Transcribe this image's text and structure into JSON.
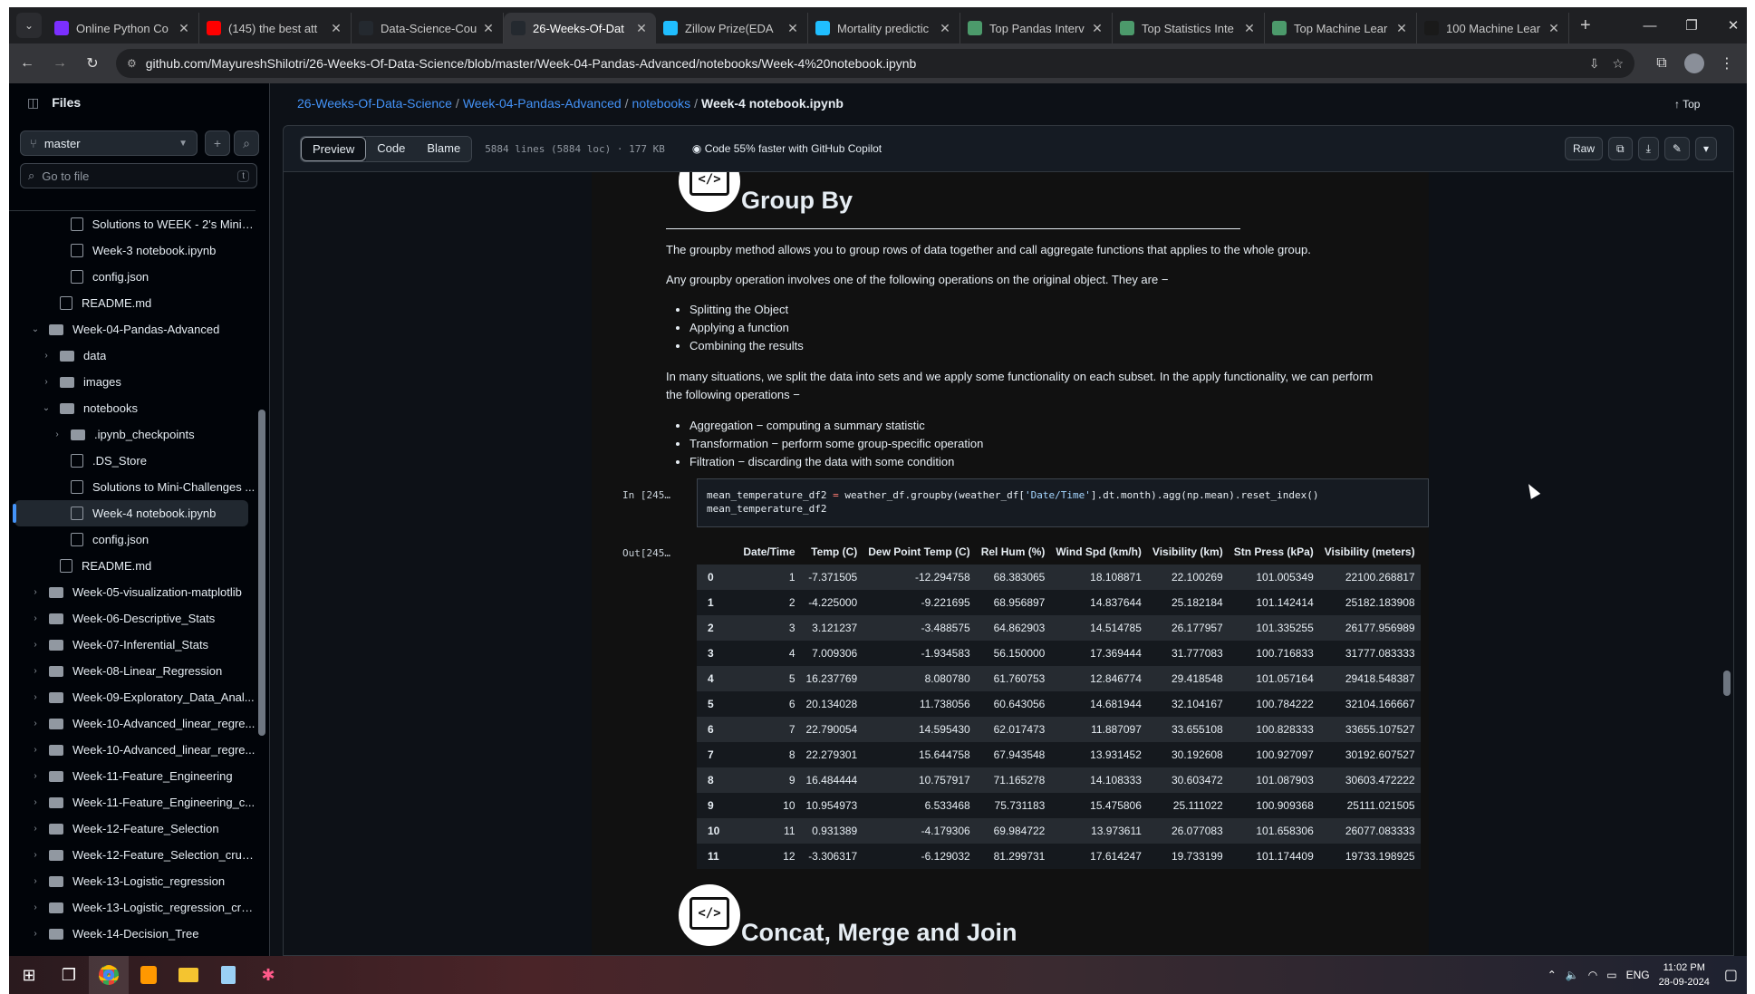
{
  "browser": {
    "tabs": [
      {
        "title": "Online Python Co",
        "icon": "python-icon",
        "color": "#7b2fff",
        "active": false
      },
      {
        "title": "(145) the best att",
        "icon": "youtube-icon",
        "color": "#ff0000",
        "active": false
      },
      {
        "title": "Data-Science-Cou",
        "icon": "github-icon",
        "color": "#24292f",
        "active": false
      },
      {
        "title": "26-Weeks-Of-Dat",
        "icon": "github-icon",
        "color": "#24292f",
        "active": true
      },
      {
        "title": "Zillow Prize(EDA",
        "icon": "kaggle-icon",
        "color": "#20beff",
        "active": false
      },
      {
        "title": "Mortality predictic",
        "icon": "kaggle-icon",
        "color": "#20beff",
        "active": false
      },
      {
        "title": "Top Pandas Interv",
        "icon": "website-icon",
        "color": "#4c9a6b",
        "active": false
      },
      {
        "title": "Top Statistics Inte",
        "icon": "website-icon",
        "color": "#4c9a6b",
        "active": false
      },
      {
        "title": "Top Machine Lear",
        "icon": "website-icon",
        "color": "#4c9a6b",
        "active": false
      },
      {
        "title": "100 Machine Lear",
        "icon": "website-icon",
        "color": "#1a1a1a",
        "active": false
      }
    ],
    "url": "github.com/MayureshShilotri/26-Weeks-Of-Data-Science/blob/master/Week-04-Pandas-Advanced/notebooks/Week-4%20notebook.ipynb"
  },
  "sidebar": {
    "title": "Files",
    "branch": "master",
    "search_placeholder": "Go to file",
    "search_shortcut": "t",
    "tree": [
      {
        "label": "Solutions to WEEK - 2's Mini C...",
        "type": "file",
        "depth": 2
      },
      {
        "label": "Week-3 notebook.ipynb",
        "type": "file",
        "depth": 2
      },
      {
        "label": "config.json",
        "type": "file",
        "depth": 2
      },
      {
        "label": "README.md",
        "type": "file",
        "depth": 1
      },
      {
        "label": "Week-04-Pandas-Advanced",
        "type": "dir-open",
        "depth": 0
      },
      {
        "label": "data",
        "type": "dir",
        "depth": 1
      },
      {
        "label": "images",
        "type": "dir",
        "depth": 1
      },
      {
        "label": "notebooks",
        "type": "dir-open",
        "depth": 1
      },
      {
        "label": ".ipynb_checkpoints",
        "type": "dir",
        "depth": 2
      },
      {
        "label": ".DS_Store",
        "type": "file",
        "depth": 2
      },
      {
        "label": "Solutions to Mini-Challenges ...",
        "type": "file",
        "depth": 2
      },
      {
        "label": "Week-4 notebook.ipynb",
        "type": "file",
        "depth": 2,
        "selected": true
      },
      {
        "label": "config.json",
        "type": "file",
        "depth": 2
      },
      {
        "label": "README.md",
        "type": "file",
        "depth": 1
      },
      {
        "label": "Week-05-visualization-matplotlib",
        "type": "dir",
        "depth": 0
      },
      {
        "label": "Week-06-Descriptive_Stats",
        "type": "dir",
        "depth": 0
      },
      {
        "label": "Week-07-Inferential_Stats",
        "type": "dir",
        "depth": 0
      },
      {
        "label": "Week-08-Linear_Regression",
        "type": "dir",
        "depth": 0
      },
      {
        "label": "Week-09-Exploratory_Data_Anal...",
        "type": "dir",
        "depth": 0
      },
      {
        "label": "Week-10-Advanced_linear_regre...",
        "type": "dir",
        "depth": 0
      },
      {
        "label": "Week-10-Advanced_linear_regre...",
        "type": "dir",
        "depth": 0
      },
      {
        "label": "Week-11-Feature_Engineering",
        "type": "dir",
        "depth": 0
      },
      {
        "label": "Week-11-Feature_Engineering_c...",
        "type": "dir",
        "depth": 0
      },
      {
        "label": "Week-12-Feature_Selection",
        "type": "dir",
        "depth": 0
      },
      {
        "label": "Week-12-Feature_Selection_cruc...",
        "type": "dir",
        "depth": 0
      },
      {
        "label": "Week-13-Logistic_regression",
        "type": "dir",
        "depth": 0
      },
      {
        "label": "Week-13-Logistic_regression_cru...",
        "type": "dir",
        "depth": 0
      },
      {
        "label": "Week-14-Decision_Tree",
        "type": "dir",
        "depth": 0
      }
    ]
  },
  "breadcrumb": {
    "parts": [
      "26-Weeks-Of-Data-Science",
      "Week-04-Pandas-Advanced",
      "notebooks"
    ],
    "current": "Week-4 notebook.ipynb",
    "top_label": "Top"
  },
  "filebar": {
    "tabs": [
      "Preview",
      "Code",
      "Blame"
    ],
    "meta": "5884 lines (5884 loc) · 177 KB",
    "copilot": "Code 55% faster with GitHub Copilot",
    "raw_label": "Raw"
  },
  "notebook": {
    "heading1": "Group By",
    "p1": "The groupby method allows you to group rows of data together and call aggregate functions that applies to the whole group.",
    "p2": "Any groupby operation involves one of the following operations on the original object. They are −",
    "list1": [
      "Splitting the Object",
      "Applying a function",
      "Combining the results"
    ],
    "p3": "In many situations, we split the data into sets and we apply some functionality on each subset. In the apply functionality, we can perform the following operations −",
    "list2": [
      "Aggregation − computing a summary statistic",
      "Transformation − perform some group-specific operation",
      "Filtration − discarding the data with some condition"
    ],
    "in_prompt": "In [245…",
    "out_prompt": "Out[245…",
    "code_line1_a": "mean_temperature_df2 ",
    "code_line1_op": "=",
    "code_line1_b": " weather_df.groupby(weather_df[",
    "code_line1_str": "'Date/Time'",
    "code_line1_c": "].dt.month).agg(np.mean).reset_index()",
    "code_line2": "mean_temperature_df2",
    "heading2": "Concat, Merge and Join",
    "table": {
      "columns": [
        "",
        "Date/Time",
        "Temp (C)",
        "Dew Point Temp (C)",
        "Rel Hum (%)",
        "Wind Spd (km/h)",
        "Visibility (km)",
        "Stn Press (kPa)",
        "Visibility (meters)"
      ],
      "rows": [
        [
          "0",
          "1",
          "-7.371505",
          "-12.294758",
          "68.383065",
          "18.108871",
          "22.100269",
          "101.005349",
          "22100.268817"
        ],
        [
          "1",
          "2",
          "-4.225000",
          "-9.221695",
          "68.956897",
          "14.837644",
          "25.182184",
          "101.142414",
          "25182.183908"
        ],
        [
          "2",
          "3",
          "3.121237",
          "-3.488575",
          "64.862903",
          "14.514785",
          "26.177957",
          "101.335255",
          "26177.956989"
        ],
        [
          "3",
          "4",
          "7.009306",
          "-1.934583",
          "56.150000",
          "17.369444",
          "31.777083",
          "100.716833",
          "31777.083333"
        ],
        [
          "4",
          "5",
          "16.237769",
          "8.080780",
          "61.760753",
          "12.846774",
          "29.418548",
          "101.057164",
          "29418.548387"
        ],
        [
          "5",
          "6",
          "20.134028",
          "11.738056",
          "60.643056",
          "14.681944",
          "32.104167",
          "100.784222",
          "32104.166667"
        ],
        [
          "6",
          "7",
          "22.790054",
          "14.595430",
          "62.017473",
          "11.887097",
          "33.655108",
          "100.828333",
          "33655.107527"
        ],
        [
          "7",
          "8",
          "22.279301",
          "15.644758",
          "67.943548",
          "13.931452",
          "30.192608",
          "100.927097",
          "30192.607527"
        ],
        [
          "8",
          "9",
          "16.484444",
          "10.757917",
          "71.165278",
          "14.108333",
          "30.603472",
          "101.087903",
          "30603.472222"
        ],
        [
          "9",
          "10",
          "10.954973",
          "6.533468",
          "75.731183",
          "15.475806",
          "25.111022",
          "100.909368",
          "25111.021505"
        ],
        [
          "10",
          "11",
          "0.931389",
          "-4.179306",
          "69.984722",
          "13.973611",
          "26.077083",
          "101.658306",
          "26077.083333"
        ],
        [
          "11",
          "12",
          "-3.306317",
          "-6.129032",
          "81.299731",
          "17.614247",
          "19.733199",
          "101.174409",
          "19733.198925"
        ]
      ]
    }
  },
  "taskbar": {
    "lang": "ENG",
    "time": "11:02 PM",
    "date": "28-09-2024"
  }
}
